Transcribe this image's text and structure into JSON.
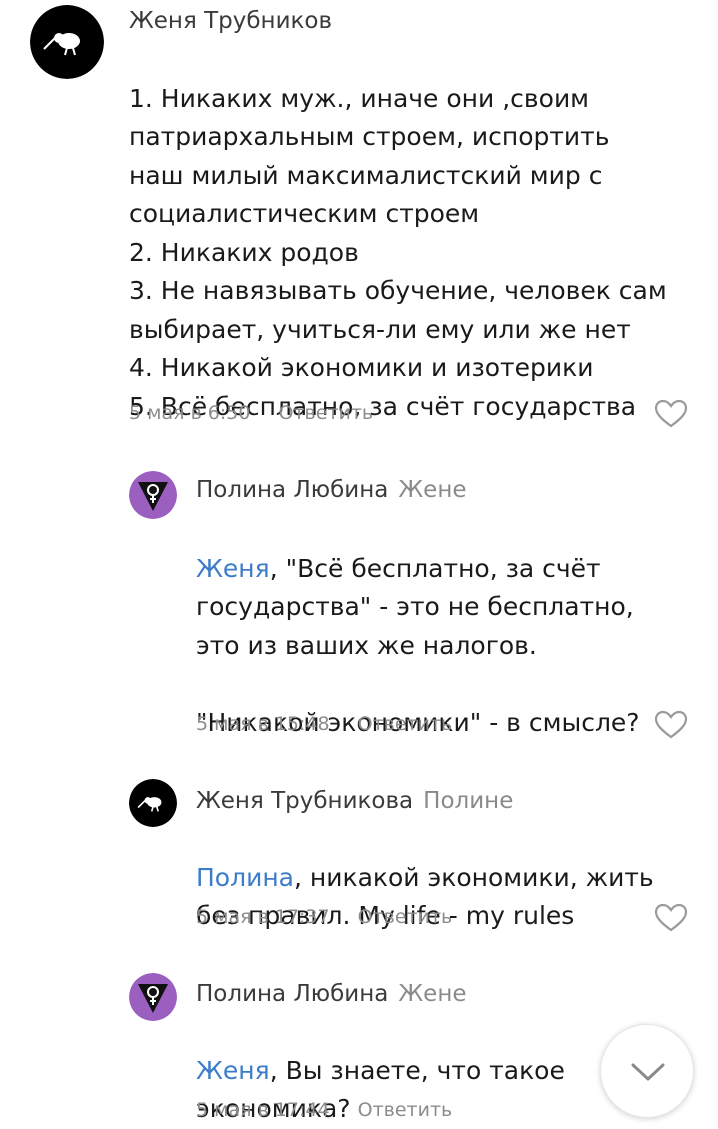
{
  "comments": [
    {
      "author": "Женя Трубников",
      "reply_to": "",
      "mention": "",
      "text": "1. Никаких муж., иначе они ,своим\nпатриархальным строем, испортить\nнаш милый максималистский мир с\nсоциалистическим строем\n2. Никаких родов\n3. Не навязывать обучение, человек сам\nвыбирает, учиться-ли ему или же нет\n4. Никакой экономики и изотерики\n5. Всё бесплатно, за счёт государства",
      "date": "5 мая в 6:50",
      "reply_label": "Ответить",
      "avatar": "kiwi-icon"
    },
    {
      "author": "Полина Любина",
      "reply_to": "Жене",
      "mention": "Женя",
      "text": ", \"Всё бесплатно, за счёт\nгосударства\" - это не бесплатно,\nэто из ваших же налогов.\n\n\"Никакой экономики\" - в смысле?",
      "date": "5 мая в 15:48",
      "reply_label": "Ответить",
      "avatar": "feminist-symbol-icon"
    },
    {
      "author": "Женя Трубникова",
      "reply_to": "Полине",
      "mention": "Полина",
      "text": ", никакой экономики, жить\nбез правил. My life - my rules",
      "date": "5 мая в 17:37",
      "reply_label": "Ответить",
      "avatar": "kiwi-icon"
    },
    {
      "author": "Полина Любина",
      "reply_to": "Жене",
      "mention": "Женя",
      "text": ", Вы знаете, что такое\nэкономика?",
      "date": "5 мая в 17:44",
      "reply_label": "Ответить",
      "avatar": "feminist-symbol-icon"
    }
  ],
  "colors": {
    "mention": "#3d7cc9",
    "meta": "#8c8c8c",
    "avatar_purple": "#9b5fc0",
    "avatar_black": "#000000"
  }
}
